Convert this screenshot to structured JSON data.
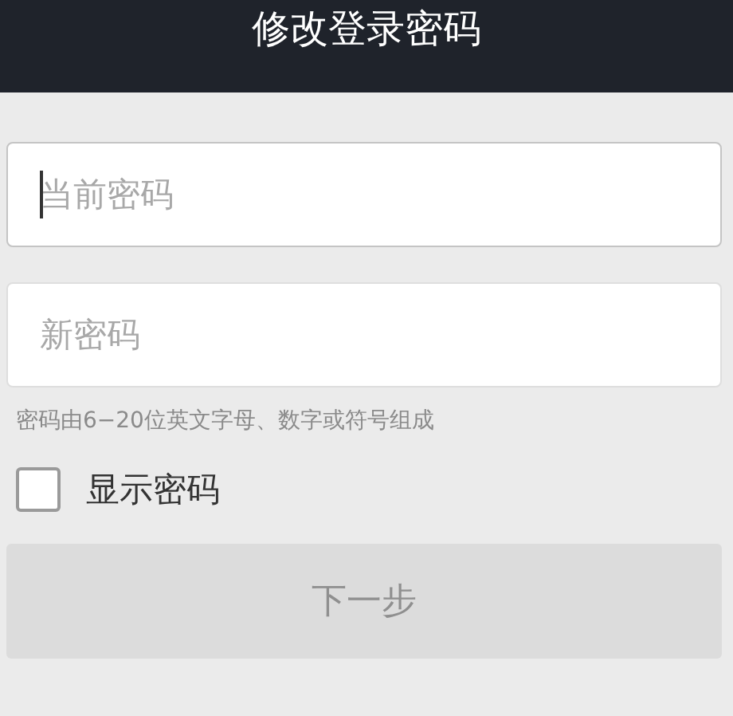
{
  "header": {
    "title": "修改登录密码"
  },
  "fields": [
    {
      "placeholder": "当前密码",
      "focused": true
    },
    {
      "placeholder": "新密码",
      "focused": false
    }
  ],
  "hint": "密码由6−20位英文字母、数字或符号组成",
  "show_password": {
    "label": "显示密码",
    "checked": false
  },
  "next_button": {
    "label": "下一步",
    "disabled": true
  }
}
